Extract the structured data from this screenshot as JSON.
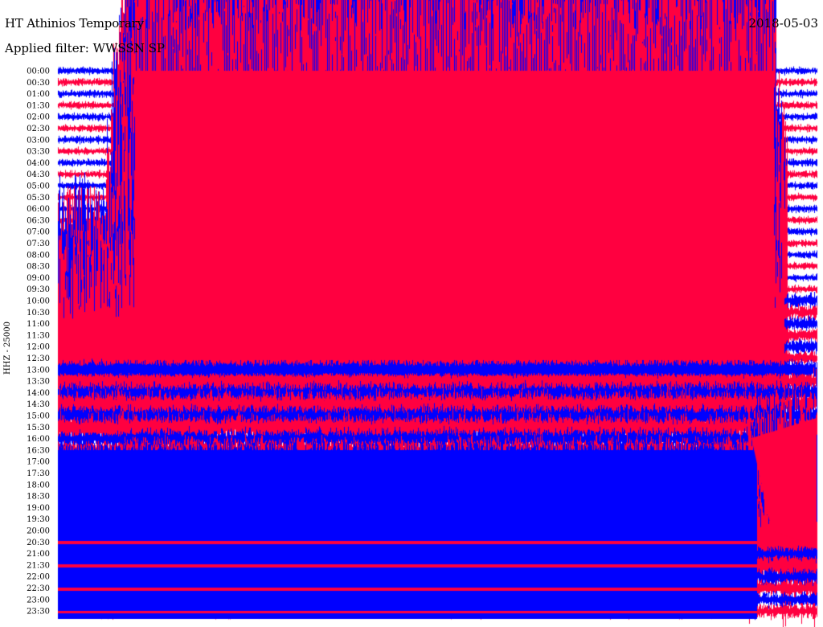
{
  "header": {
    "title": "HT Athinios Temporary",
    "date": "2018-05-03",
    "filter": "Applied filter: WWSSN SP"
  },
  "chart_data": {
    "type": "helicorder",
    "ylabel": "HHZ - 25000",
    "hour_ticks": [
      "00:00",
      "00:30",
      "01:00",
      "01:30",
      "02:00",
      "02:30",
      "03:00",
      "03:30",
      "04:00",
      "04:30",
      "05:00",
      "05:30",
      "06:00",
      "06:30",
      "07:00",
      "07:30",
      "08:00",
      "08:30",
      "09:00",
      "09:30",
      "10:00",
      "10:30",
      "11:00",
      "11:30",
      "12:00",
      "12:30",
      "13:00",
      "13:30",
      "14:00",
      "14:30",
      "15:00",
      "15:30",
      "16:00",
      "16:30",
      "17:00",
      "17:30",
      "18:00",
      "18:30",
      "19:00",
      "19:30",
      "20:00",
      "20:30",
      "21:00",
      "21:30",
      "22:00",
      "22:30",
      "23:00",
      "23:30"
    ],
    "trace_colors": {
      "even": "#0000ff",
      "odd": "#ff0040"
    },
    "minutes_per_line": 30,
    "notes": "Saturated/clipped amplitudes across most of the record; alternating blue/red traces per 30-minute line."
  }
}
